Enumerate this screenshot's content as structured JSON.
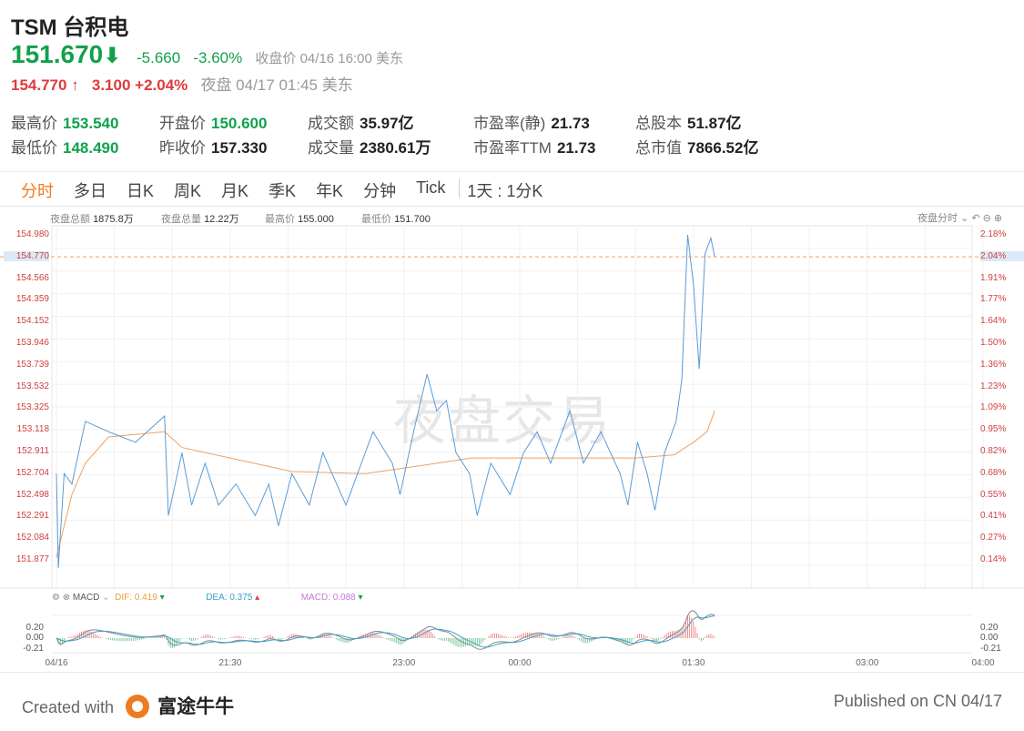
{
  "header": {
    "symbol": "TSM",
    "name": "台积电",
    "price": "151.670",
    "change": "-5.660",
    "change_pct": "-3.60%",
    "status": "收盘价 04/16 16:00 美东",
    "ah_price": "154.770",
    "ah_arrow": "↑",
    "ah_change": "3.100",
    "ah_change_pct": "+2.04%",
    "ah_status": "夜盘 04/17 01:45 美东"
  },
  "stats": [
    {
      "label": "最高价",
      "value": "153.540",
      "color": "green"
    },
    {
      "label": "开盘价",
      "value": "150.600",
      "color": "green"
    },
    {
      "label": "成交额",
      "value": "35.97亿"
    },
    {
      "label": "市盈率(静)",
      "value": "21.73"
    },
    {
      "label": "总股本",
      "value": "51.87亿"
    },
    {
      "label": "最低价",
      "value": "148.490",
      "color": "green"
    },
    {
      "label": "昨收价",
      "value": "157.330"
    },
    {
      "label": "成交量",
      "value": "2380.61万"
    },
    {
      "label": "市盈率TTM",
      "value": "21.73"
    },
    {
      "label": "总市值",
      "value": "7866.52亿"
    }
  ],
  "tabs": [
    "分时",
    "多日",
    "日K",
    "周K",
    "月K",
    "季K",
    "年K",
    "分钟",
    "Tick",
    "1天 : 1分K"
  ],
  "info": [
    {
      "label": "夜盘总额",
      "value": "1875.8万"
    },
    {
      "label": "夜盘总量",
      "value": "12.22万"
    },
    {
      "label": "最高价",
      "value": "155.000"
    },
    {
      "label": "最低价",
      "value": "151.700"
    }
  ],
  "mode_select": "夜盘分时",
  "watermark": "夜盘交易",
  "colors": {
    "up": "#e03a3a",
    "down": "#11a14b",
    "accent": "#f07a1e",
    "price_line": "#5a9bd5",
    "avg_line": "#f0a060"
  },
  "macd": {
    "name": "MACD",
    "dif": "DIF: 0.419",
    "dea": "DEA: 0.375",
    "macd": "MACD: 0.088",
    "yticks": [
      "0.20",
      "0.00",
      "-0.21"
    ]
  },
  "chart_data": {
    "type": "line",
    "yticks_left": [
      "154.980",
      "154.770",
      "154.566",
      "154.359",
      "154.152",
      "153.946",
      "153.739",
      "153.532",
      "153.325",
      "153.118",
      "152.911",
      "152.704",
      "152.498",
      "152.291",
      "152.084",
      "151.877"
    ],
    "yticks_right": [
      "2.18%",
      "2.04%",
      "1.91%",
      "1.77%",
      "1.64%",
      "1.50%",
      "1.36%",
      "1.23%",
      "1.09%",
      "0.95%",
      "0.82%",
      "0.68%",
      "0.55%",
      "0.41%",
      "0.27%",
      "0.14%"
    ],
    "xticks": [
      {
        "label": "04/16",
        "min": 0
      },
      {
        "label": "21:30",
        "min": 90
      },
      {
        "label": "23:00",
        "min": 180
      },
      {
        "label": "00:00",
        "min": 240
      },
      {
        "label": "01:30",
        "min": 330
      },
      {
        "label": "03:00",
        "min": 420
      },
      {
        "label": "04:00",
        "min": 480
      }
    ],
    "ylim": [
      151.877,
      154.98
    ],
    "last_price": 154.77,
    "series": [
      {
        "name": "price",
        "points": [
          [
            0,
            152.7
          ],
          [
            1,
            151.8
          ],
          [
            4,
            152.7
          ],
          [
            8,
            152.6
          ],
          [
            15,
            153.2
          ],
          [
            27,
            153.1
          ],
          [
            41,
            153.0
          ],
          [
            56,
            153.25
          ],
          [
            58,
            152.3
          ],
          [
            65,
            152.9
          ],
          [
            70,
            152.4
          ],
          [
            77,
            152.8
          ],
          [
            84,
            152.4
          ],
          [
            93,
            152.6
          ],
          [
            103,
            152.3
          ],
          [
            110,
            152.6
          ],
          [
            115,
            152.2
          ],
          [
            122,
            152.7
          ],
          [
            131,
            152.4
          ],
          [
            138,
            152.9
          ],
          [
            150,
            152.4
          ],
          [
            164,
            153.1
          ],
          [
            174,
            152.8
          ],
          [
            178,
            152.5
          ],
          [
            185,
            153.1
          ],
          [
            192,
            153.65
          ],
          [
            197,
            153.3
          ],
          [
            202,
            153.4
          ],
          [
            207,
            152.9
          ],
          [
            214,
            152.7
          ],
          [
            218,
            152.3
          ],
          [
            225,
            152.8
          ],
          [
            235,
            152.5
          ],
          [
            242,
            152.9
          ],
          [
            249,
            153.1
          ],
          [
            256,
            152.8
          ],
          [
            266,
            153.3
          ],
          [
            273,
            152.8
          ],
          [
            282,
            153.1
          ],
          [
            292,
            152.7
          ],
          [
            296,
            152.4
          ],
          [
            301,
            153.0
          ],
          [
            306,
            152.7
          ],
          [
            310,
            152.35
          ],
          [
            315,
            152.9
          ],
          [
            321,
            153.2
          ],
          [
            324,
            153.6
          ],
          [
            327,
            154.98
          ],
          [
            330,
            154.5
          ],
          [
            333,
            153.7
          ],
          [
            336,
            154.8
          ],
          [
            339,
            154.95
          ],
          [
            341,
            154.77
          ]
        ]
      },
      {
        "name": "average",
        "points": [
          [
            0,
            151.9
          ],
          [
            8,
            152.5
          ],
          [
            15,
            152.8
          ],
          [
            27,
            153.05
          ],
          [
            56,
            153.1
          ],
          [
            65,
            152.95
          ],
          [
            90,
            152.85
          ],
          [
            122,
            152.72
          ],
          [
            160,
            152.7
          ],
          [
            190,
            152.78
          ],
          [
            215,
            152.85
          ],
          [
            254,
            152.85
          ],
          [
            300,
            152.85
          ],
          [
            320,
            152.88
          ],
          [
            330,
            153.0
          ],
          [
            337,
            153.1
          ],
          [
            341,
            153.3
          ]
        ]
      }
    ]
  },
  "footer": {
    "created": "Created with",
    "brand": "富途牛牛",
    "published": "Published on CN 04/17"
  }
}
